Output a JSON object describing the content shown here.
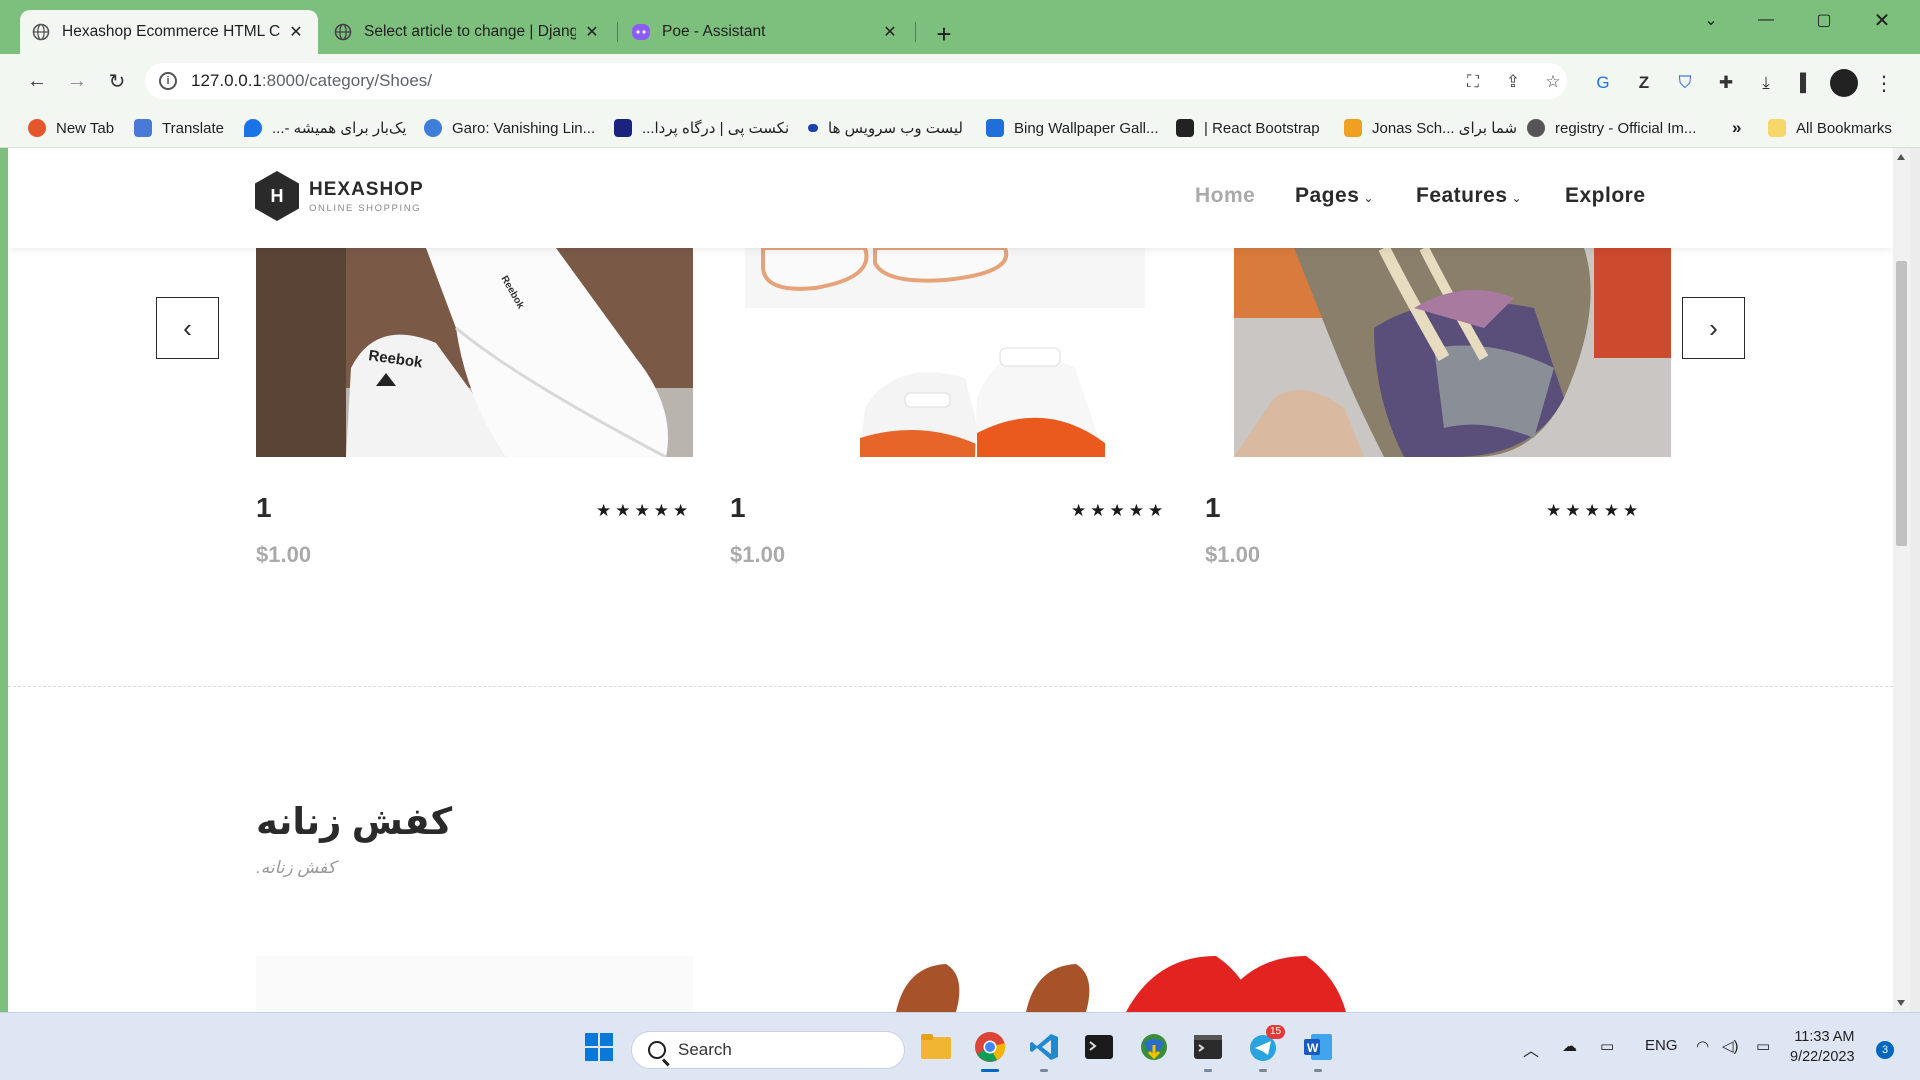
{
  "browser": {
    "tabs": [
      {
        "title": "Hexashop Ecommerce HTML CSS",
        "active": true,
        "icon": "globe-icon"
      },
      {
        "title": "Select article to change | Django",
        "active": false,
        "icon": "globe-icon"
      },
      {
        "title": "Poe - Assistant",
        "active": false,
        "icon": "poe-icon"
      }
    ],
    "url_host": "127.0.0.1",
    "url_rest": ":8000/category/Shoes/",
    "bookmarks": [
      {
        "label": "New Tab",
        "color": "#e4562b"
      },
      {
        "label": "Translate",
        "color": "#4a7ad8"
      },
      {
        "label": "...- یک‌بار برای همیشه",
        "color": "#1a73e8"
      },
      {
        "label": "Garo: Vanishing Lin...",
        "color": "#3e7ed8"
      },
      {
        "label": "...نکست پی | درگاه پردا",
        "color": "#1a237e"
      },
      {
        "label": "لیست وب سرویس ها",
        "color": "#1e40af"
      },
      {
        "label": "Bing Wallpaper Gall...",
        "color": "#1e6fd9"
      },
      {
        "label": "| React Bootstrap",
        "color": "#222222"
      },
      {
        "label": "Jonas Sch... شما برای",
        "color": "#f0a020"
      },
      {
        "label": "registry - Official Im...",
        "color": "#555555"
      }
    ],
    "bookmarks_overflow": "»",
    "all_bookmarks": "All Bookmarks"
  },
  "site": {
    "brand": "HEXASHOP",
    "tagline": "ONLINE SHOPPING",
    "logo_letter": "H",
    "nav": [
      {
        "label": "Home",
        "active": true,
        "dropdown": false
      },
      {
        "label": "Pages",
        "active": false,
        "dropdown": true
      },
      {
        "label": "Features",
        "active": false,
        "dropdown": true
      },
      {
        "label": "Explore",
        "active": false,
        "dropdown": false
      }
    ],
    "products": [
      {
        "name": "1",
        "price": "$1.00",
        "rating": 5
      },
      {
        "name": "1",
        "price": "$1.00",
        "rating": 5
      },
      {
        "name": "1",
        "price": "$1.00",
        "rating": 5
      }
    ],
    "prev_glyph": "‹",
    "next_glyph": "›",
    "section": {
      "title": "کفش زنانه",
      "subtitle": "کفش زنانه."
    }
  },
  "taskbar": {
    "search_placeholder": "Search",
    "lang": "ENG",
    "time": "11:33 AM",
    "date": "9/22/2023",
    "notification_count": "3",
    "telegram_badge": "15",
    "accent": "#0067c0"
  }
}
